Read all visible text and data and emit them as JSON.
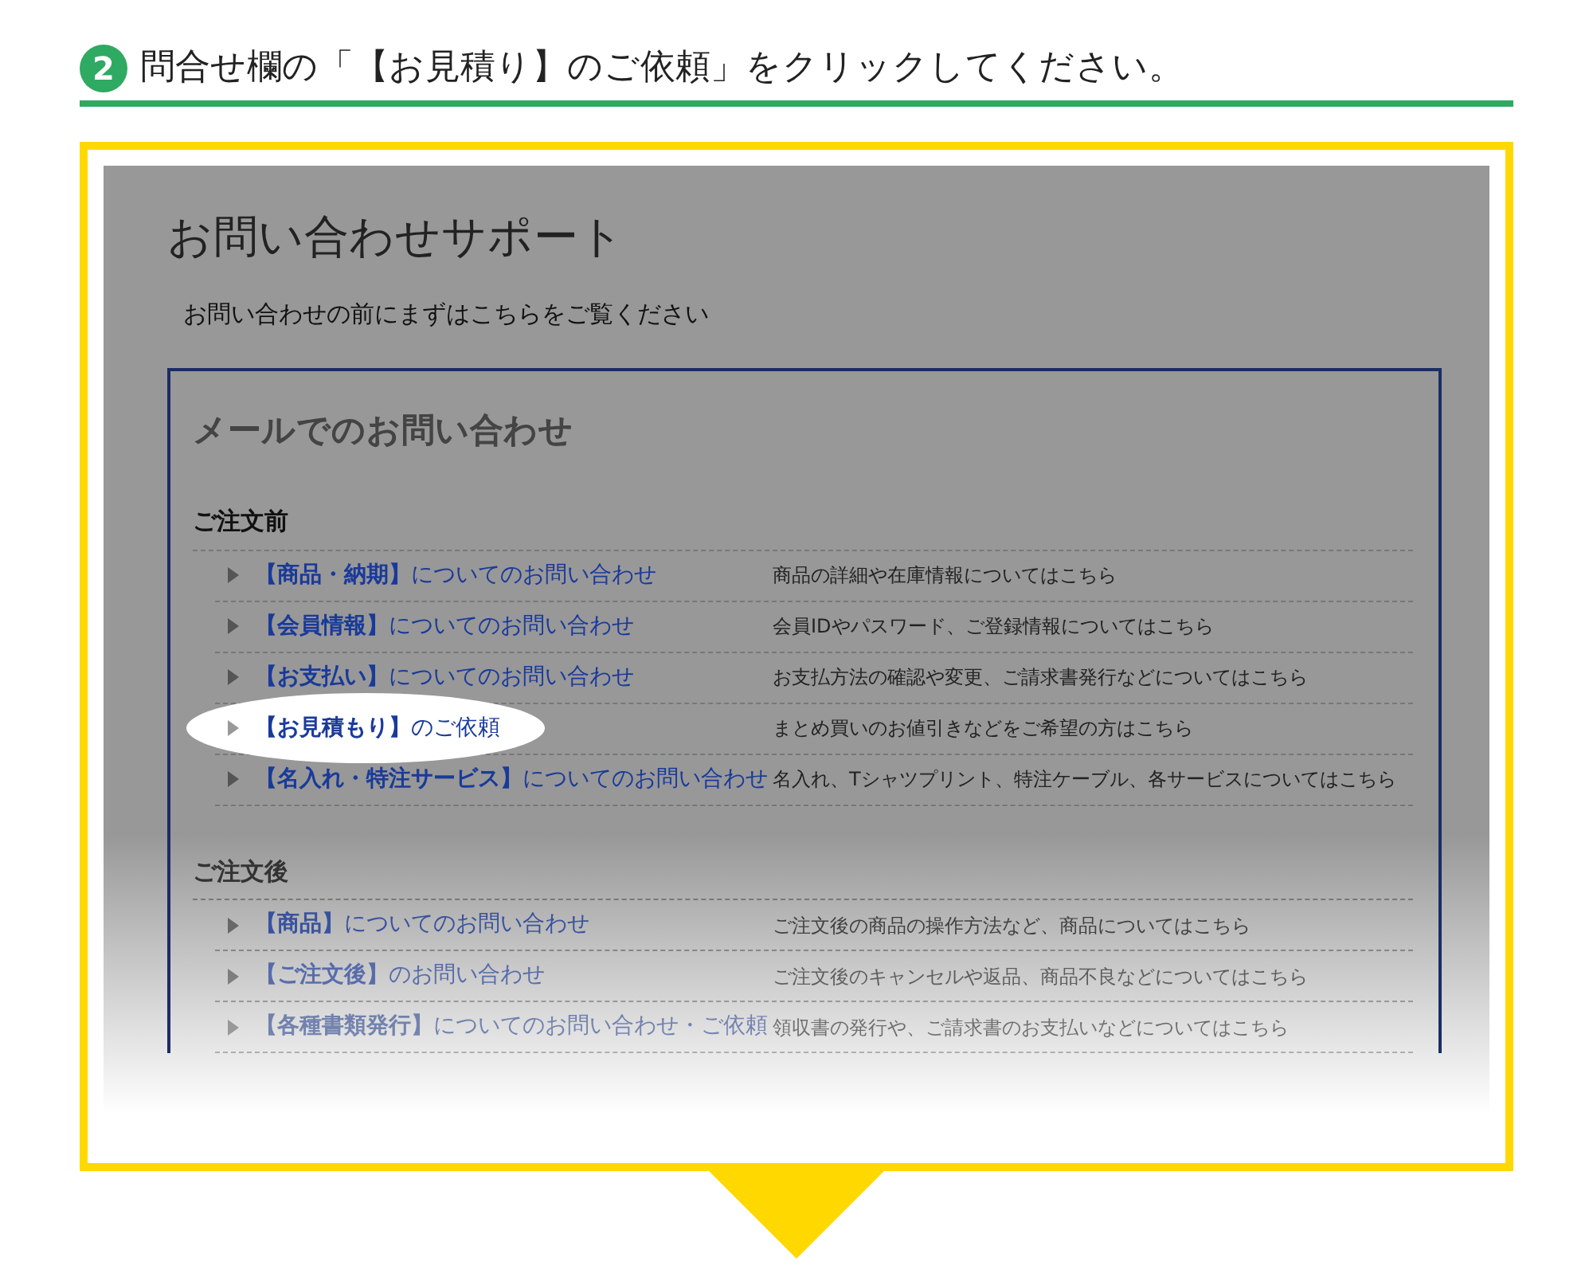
{
  "step": {
    "number": "2",
    "instruction": "問合せ欄の「【お見積り】のご依頼」をクリックしてください。"
  },
  "page": {
    "title": "お問い合わせサポート",
    "subtitle": "お問い合わせの前にまずはこちらをご覧ください",
    "panel": {
      "heading": "メールでのお問い合わせ",
      "sections": [
        {
          "title": "ご注文前",
          "rows": [
            {
              "link": "**【商品・納期】**についてのお問い合わせ",
              "description": "商品の詳細や在庫情報についてはこちら",
              "selected": false
            },
            {
              "link": "**【会員情報】**についてのお問い合わせ",
              "description": "会員IDやパスワード、ご登録情報についてはこちら",
              "selected": false
            },
            {
              "link": "**【お支払い】**についてのお問い合わせ",
              "description": "お支払方法の確認や変更、ご請求書発行などについてはこちら",
              "selected": false
            },
            {
              "link": "**【お見積もり】**のご依頼",
              "description": "まとめ買いのお値引きなどをご希望の方はこちら",
              "selected": true
            },
            {
              "link": "**【名入れ・特注サービス】**についてのお問い合わせ",
              "description": "名入れ、Tシャツプリント、特注ケーブル、各サービスについてはこちら",
              "selected": false
            }
          ]
        },
        {
          "title": "ご注文後",
          "rows": [
            {
              "link": "**【商品】**についてのお問い合わせ",
              "description": "ご注文後の商品の操作方法など、商品についてはこちら",
              "selected": false
            },
            {
              "link": "**【ご注文後】**のお問い合わせ",
              "description": "ご注文後のキャンセルや返品、商品不良などについてはこちら",
              "selected": false
            },
            {
              "link": "**【各種書類発行】**についてのお問い合わせ・ご依頼",
              "description": "領収書の発行や、ご請求書のお支払いなどについてはこちら",
              "selected": false
            }
          ]
        }
      ]
    }
  }
}
